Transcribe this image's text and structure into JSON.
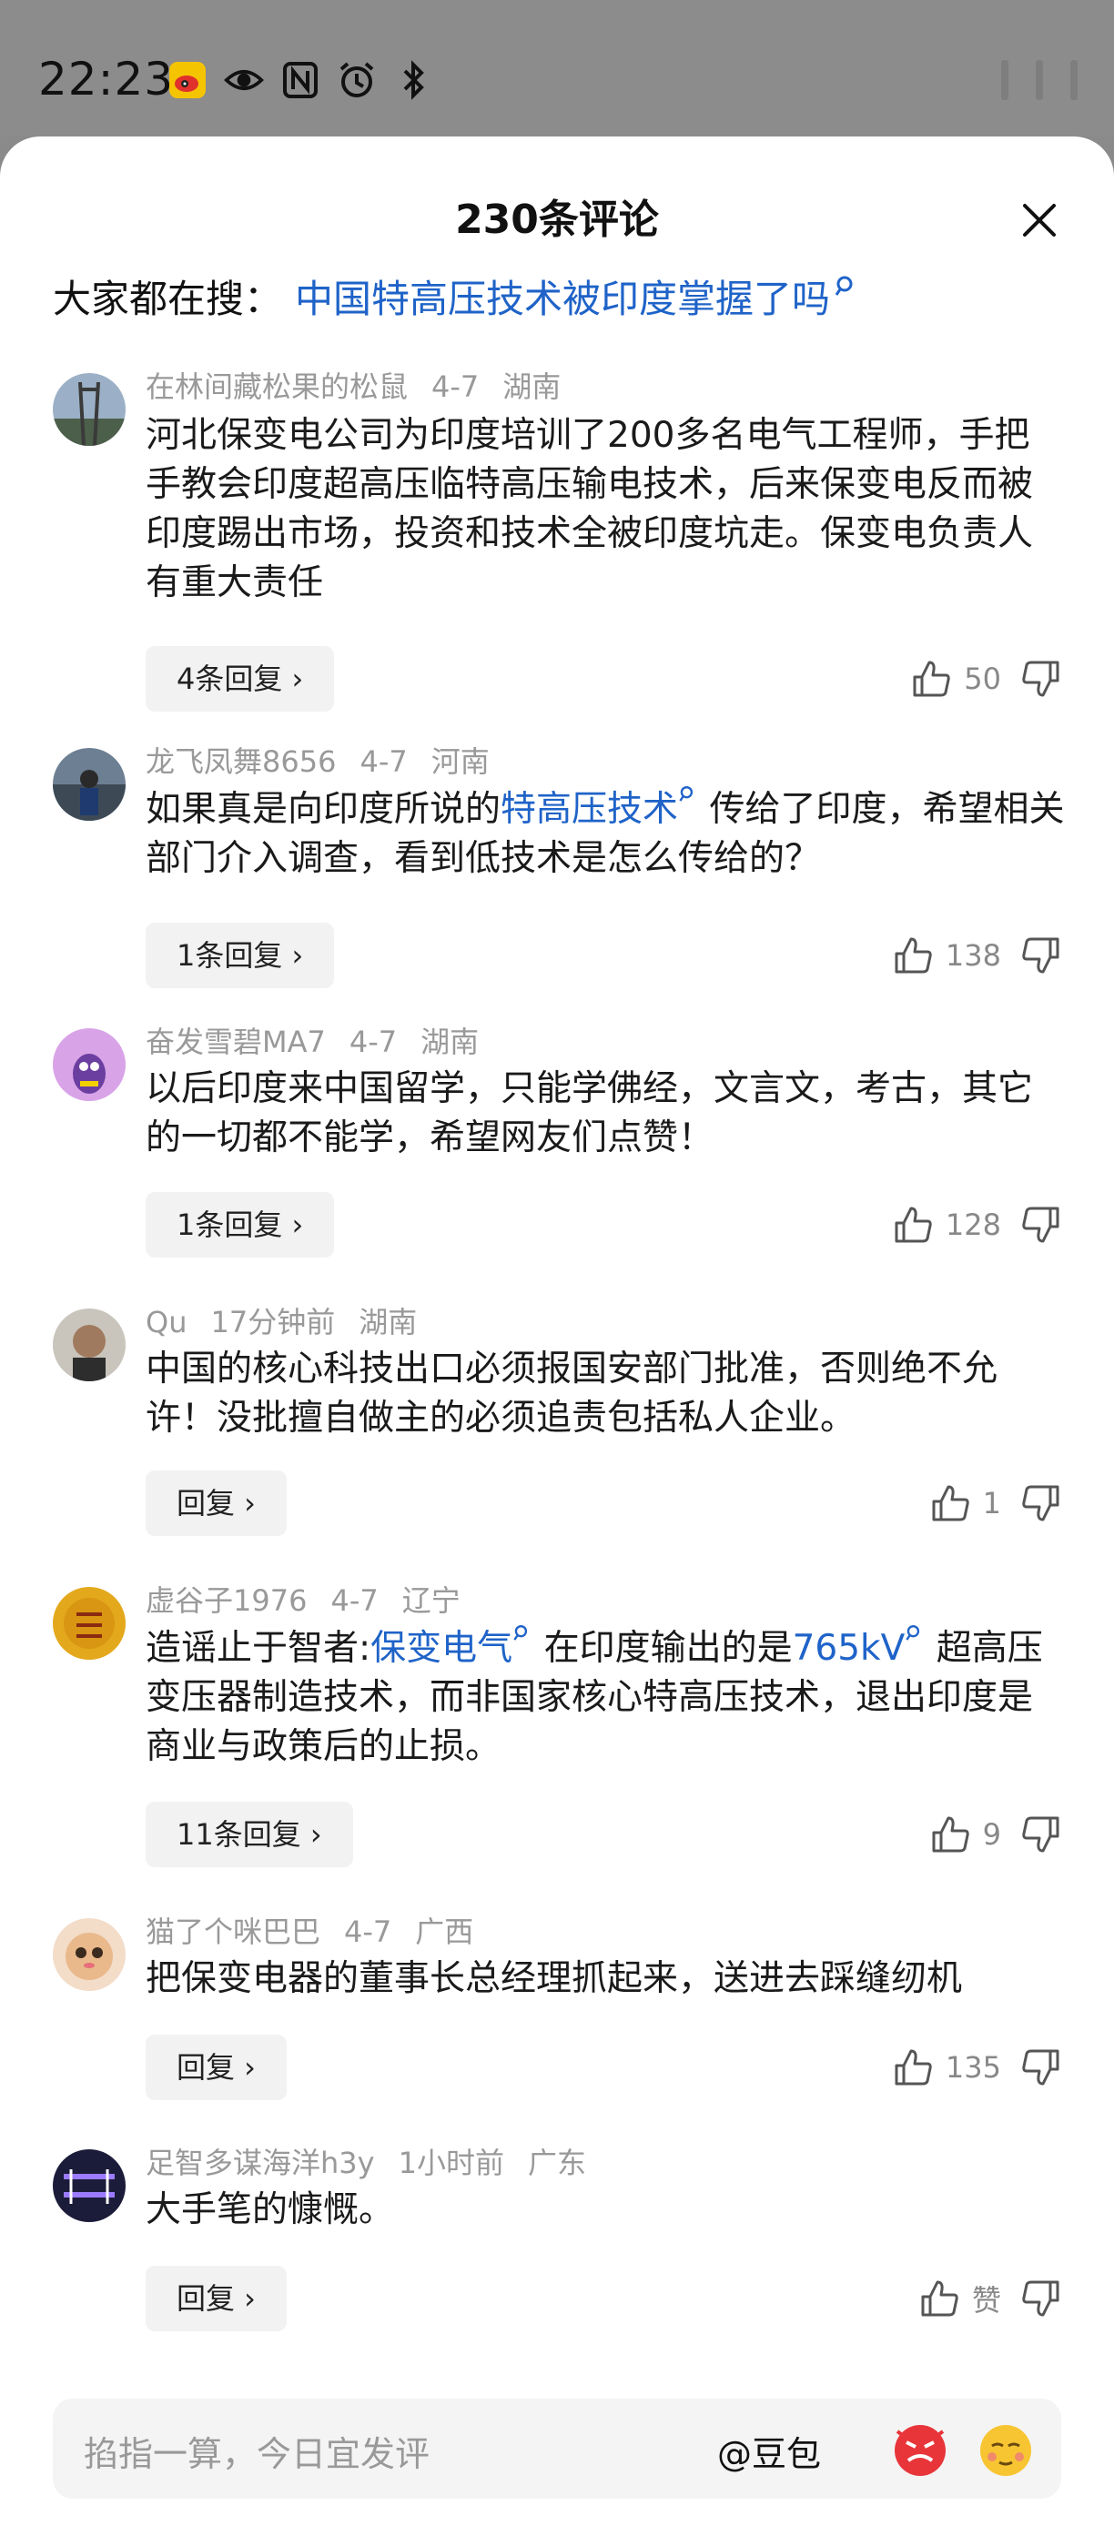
{
  "status_bar": {
    "time": "22:23"
  },
  "header": {
    "title": "230条评论"
  },
  "search": {
    "label": "大家都在搜：",
    "query": "中国特高压技术被印度掌握了吗"
  },
  "comments": [
    {
      "user": "在林间藏松果的松鼠",
      "date": "4-7",
      "region": "湖南",
      "text_parts": [
        "河北保变电公司为印度培训了200多名电气工程师，手把手教会印度超高压临特高压输电技术，后来保变电反而被印度踢出市场，投资和技术全被印度坑走。保变电负责人有重大责任"
      ],
      "replies": "4条回复 ›",
      "likes": "50"
    },
    {
      "user": "龙飞凤舞8656",
      "date": "4-7",
      "region": "河南",
      "text_parts": [
        "如果真是向印度所说的",
        "特高压技术",
        "传给了印度，希望相关部门介入调查，看到低技术是怎么传给的？"
      ],
      "replies": "1条回复 ›",
      "likes": "138"
    },
    {
      "user": "奋发雪碧MA7",
      "date": "4-7",
      "region": "湖南",
      "text_parts": [
        "以后印度来中国留学，只能学佛经，文言文，考古，其它的一切都不能学，希望网友们点赞！"
      ],
      "replies": "1条回复 ›",
      "likes": "128"
    },
    {
      "user": "Qu",
      "date": "17分钟前",
      "region": "湖南",
      "text_parts": [
        "中国的核心科技出口必须报国安部门批准，否则绝不允许！没批擅自做主的必须追责包括私人企业。"
      ],
      "replies": "回复 ›",
      "likes": "1"
    },
    {
      "user": "虚谷子1976",
      "date": "4-7",
      "region": "辽宁",
      "text_parts": [
        "造谣止于智者:",
        "保变电气",
        "在印度输出的是",
        "765kV",
        "超高压变压器制造技术，而非国家核心特高压技术，退出印度是商业与政策后的止损。"
      ],
      "replies": "11条回复 ›",
      "likes": "9"
    },
    {
      "user": "猫了个咪巴巴",
      "date": "4-7",
      "region": "广西",
      "text_parts": [
        "把保变电器的董事长总经理抓起来，送进去踩缝纫机"
      ],
      "replies": "回复 ›",
      "likes": "135"
    },
    {
      "user": "足智多谋海洋h3y",
      "date": "1小时前",
      "region": "广东",
      "text_parts": [
        "大手笔的慷慨。"
      ],
      "replies": "回复 ›",
      "likes": "赞"
    }
  ],
  "composer": {
    "placeholder": "掐指一算，今日宜发评",
    "at_label": "@豆包"
  },
  "colors": {
    "link": "#1f63c8",
    "meta": "#999999",
    "pill_bg": "#f2f2f2"
  }
}
